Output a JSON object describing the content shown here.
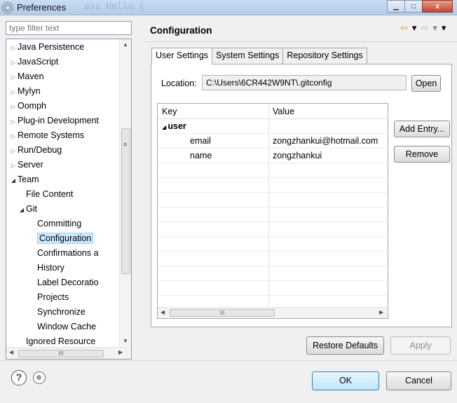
{
  "window": {
    "title": "Preferences",
    "ghost_title": "ass Hello {",
    "minimize": "▁",
    "maximize": "□",
    "close": "x"
  },
  "filter": {
    "placeholder": "type filter text"
  },
  "tree": {
    "items": [
      {
        "label": "Java Persistence",
        "level": 0,
        "state": "collapsed"
      },
      {
        "label": "JavaScript",
        "level": 0,
        "state": "collapsed"
      },
      {
        "label": "Maven",
        "level": 0,
        "state": "collapsed"
      },
      {
        "label": "Mylyn",
        "level": 0,
        "state": "collapsed"
      },
      {
        "label": "Oomph",
        "level": 0,
        "state": "collapsed"
      },
      {
        "label": "Plug-in Development",
        "level": 0,
        "state": "collapsed"
      },
      {
        "label": "Remote Systems",
        "level": 0,
        "state": "collapsed"
      },
      {
        "label": "Run/Debug",
        "level": 0,
        "state": "collapsed"
      },
      {
        "label": "Server",
        "level": 0,
        "state": "collapsed"
      },
      {
        "label": "Team",
        "level": 0,
        "state": "expanded"
      },
      {
        "label": "File Content",
        "level": 1,
        "state": "leaf"
      },
      {
        "label": "Git",
        "level": 1,
        "state": "expanded"
      },
      {
        "label": "Committing",
        "level": 2,
        "state": "leaf"
      },
      {
        "label": "Configuration",
        "level": 2,
        "state": "leaf",
        "selected": true
      },
      {
        "label": "Confirmations a",
        "level": 2,
        "state": "leaf"
      },
      {
        "label": "History",
        "level": 2,
        "state": "leaf"
      },
      {
        "label": "Label Decoratio",
        "level": 2,
        "state": "leaf"
      },
      {
        "label": "Projects",
        "level": 2,
        "state": "leaf"
      },
      {
        "label": "Synchronize",
        "level": 2,
        "state": "leaf"
      },
      {
        "label": "Window Cache",
        "level": 2,
        "state": "leaf"
      },
      {
        "label": "Ignored Resource",
        "level": 1,
        "state": "leaf"
      }
    ]
  },
  "page": {
    "title": "Configuration",
    "nav": {
      "back": "⇦",
      "back_menu": "▾",
      "forward": "⇨",
      "forward_menu": "▾",
      "view_menu": "▾"
    }
  },
  "tabs": [
    {
      "label": "User Settings",
      "active": true
    },
    {
      "label": "System Settings",
      "active": false
    },
    {
      "label": "Repository Settings",
      "active": false
    }
  ],
  "location": {
    "label": "Location:",
    "value": "C:\\Users\\6CR442W9NT\\.gitconfig",
    "open_button": "Open"
  },
  "table": {
    "columns": [
      "Key",
      "Value"
    ],
    "rows": [
      {
        "key": "user",
        "value": "",
        "section": true
      },
      {
        "key": "email",
        "value": "zongzhankui@hotmail.com",
        "section": false
      },
      {
        "key": "name",
        "value": "zongzhankui",
        "section": false
      }
    ],
    "empty_row_count": 11,
    "scroll_grip": "III"
  },
  "side_buttons": {
    "add_entry": "Add Entry...",
    "remove": "Remove"
  },
  "bottom_buttons": {
    "restore_defaults": "Restore Defaults",
    "apply": "Apply"
  },
  "footer": {
    "help": "?",
    "ok": "OK",
    "cancel": "Cancel"
  },
  "colors": {
    "selection": "#cce8ff",
    "selection_border": "#99d1ff",
    "titlebar": "#c9dcf2",
    "close_button": "#c5432a"
  }
}
